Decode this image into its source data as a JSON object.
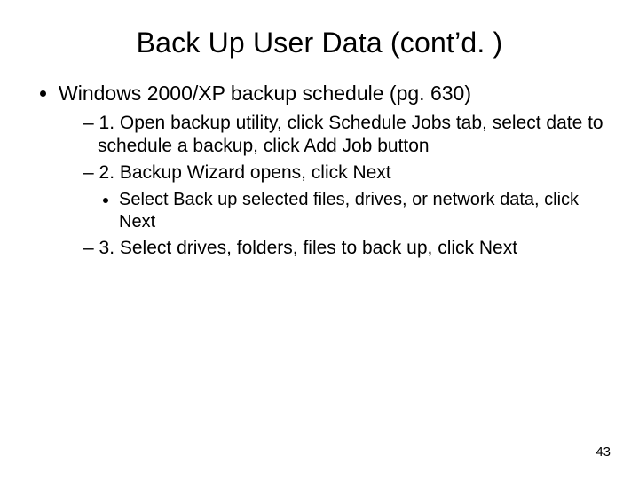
{
  "title": "Back Up User Data (cont’d. )",
  "bullets": {
    "main": "Windows 2000/XP backup schedule (pg. 630)",
    "sub1": "1. Open backup utility, click Schedule Jobs tab, select date to schedule a backup, click Add Job button",
    "sub2": "2. Backup Wizard opens, click Next",
    "sub2a": "Select Back up selected files, drives, or network data, click Next",
    "sub3": "3. Select drives, folders, files to back up, click Next"
  },
  "page_number": "43"
}
